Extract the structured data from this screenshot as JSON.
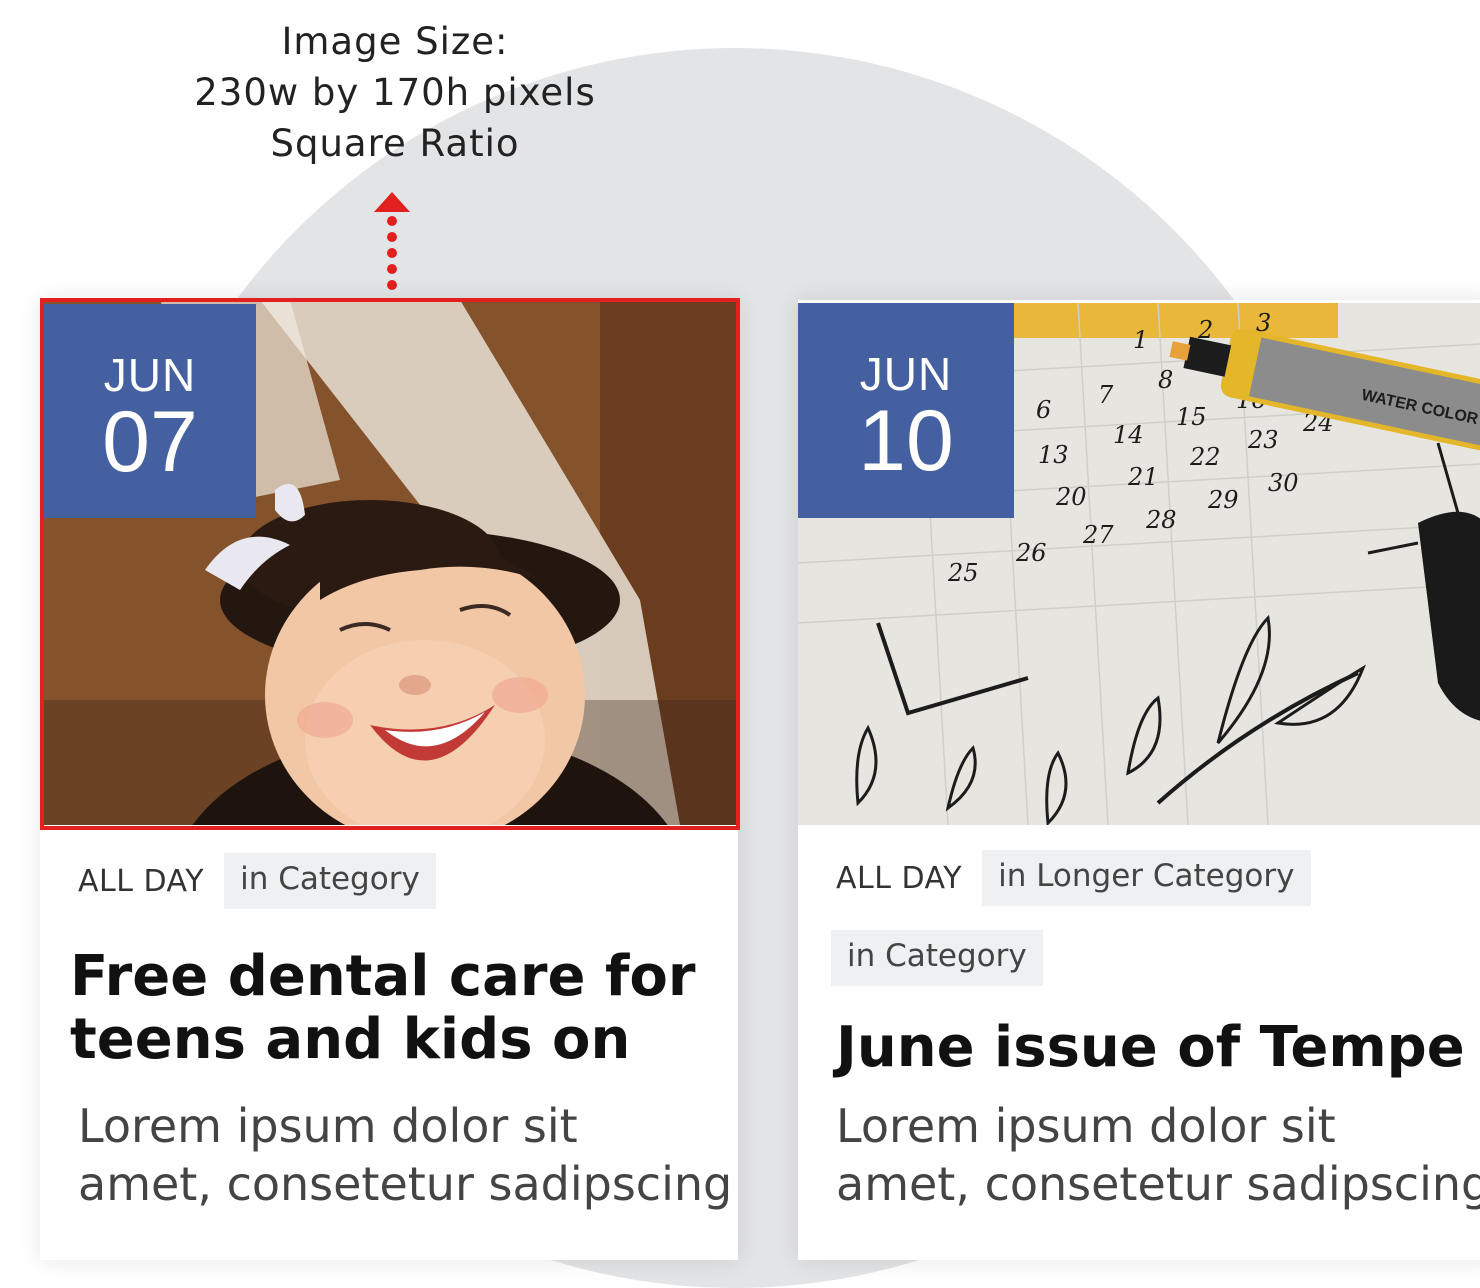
{
  "annotation": {
    "lines": [
      "Image Size:",
      "230w by 170h pixels",
      "Square Ratio"
    ]
  },
  "colors": {
    "accent_blue": "#4560a0",
    "highlight_red": "#e32020",
    "circle_gray": "#e3e4e6",
    "tag_bg": "#eef0f2"
  },
  "cards": [
    {
      "date": {
        "month": "JUN",
        "day": "07"
      },
      "image": "smiling-child-photo",
      "time": "ALL DAY",
      "categories": [
        "in Category"
      ],
      "title_lines": [
        "Free dental care for",
        "teens and kids on"
      ],
      "description_lines": [
        "Lorem ipsum dolor sit",
        "amet, consetetur sadipscing"
      ]
    },
    {
      "date": {
        "month": "JUN",
        "day": "10"
      },
      "image": "calendar-marker-photo",
      "time": "ALL DAY",
      "categories": [
        "in Longer Category",
        "in Category"
      ],
      "title_lines": [
        "June issue of Tempe"
      ],
      "description_lines": [
        "Lorem ipsum dolor sit",
        "amet, consetetur sadipscing"
      ]
    }
  ]
}
